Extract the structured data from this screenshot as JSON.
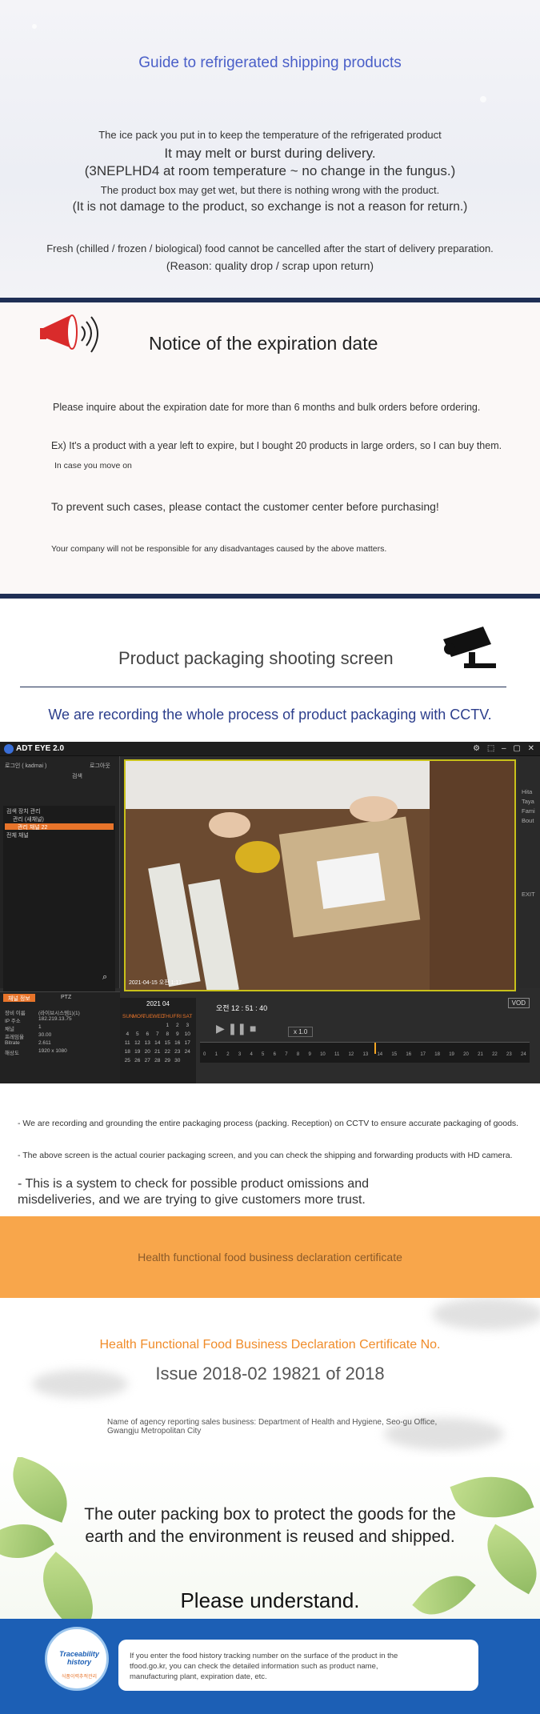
{
  "refrigerated": {
    "title": "Guide to refrigerated shipping products",
    "line1": "The ice pack you put in to keep the temperature of the refrigerated product",
    "line2": "It may melt or burst during delivery.",
    "line3": "(3NEPLHD4 at room temperature ~ no change in the fungus.)",
    "line4": "The product box may get wet, but there is nothing wrong with the product.",
    "line5": "(It is not damage to the product, so exchange is not a reason for return.)",
    "line6": "Fresh (chilled / frozen / biological) food cannot be cancelled after the start of delivery preparation.",
    "line7": "(Reason: quality drop / scrap upon return)"
  },
  "expiration": {
    "title": "Notice of the expiration date",
    "p1": "Please inquire about the expiration date for more than 6 months and bulk orders before ordering.",
    "p2": "Ex) It's a product with a year left to expire, but I bought 20 products in large orders, so I can buy them.",
    "p3": "In case you move on",
    "p4": "To prevent such cases, please contact the customer center before purchasing!",
    "p5": "Your company will not be responsible for any disadvantages caused by the above matters."
  },
  "cctv": {
    "title": "Product packaging shooting screen",
    "subtitle": "We are recording the whole process of product packaging with CCTV."
  },
  "app": {
    "title": "ADT EYE 2.0",
    "login_label": "로그인 ( kadmai )",
    "logout_label": "로그아웃",
    "search_label": "검색",
    "tree": [
      "검색 장치 관리",
      "관리 (새채널)",
      "관리 채널 22",
      "전체 채널"
    ],
    "right_labels": [
      "Hita",
      "Taya",
      "Fami",
      "Bout"
    ],
    "exit_label": "EXIT",
    "info_tabs": [
      "채널 정보",
      "PTZ"
    ],
    "info_rows": [
      {
        "k": "장비 이름",
        "v": "(라이브시스템1)(1)"
      },
      {
        "k": "IP 주소",
        "v": "182.219.13.75"
      },
      {
        "k": "채널",
        "v": "1"
      },
      {
        "k": "프레임율",
        "v": "30.00"
      },
      {
        "k": "Bitrate",
        "v": "2.611"
      },
      {
        "k": "해상도",
        "v": "1920 x 1080"
      }
    ],
    "calendar": {
      "month": "2021  04",
      "days": [
        "SUN",
        "MON",
        "TUE",
        "WED",
        "THU",
        "FRI",
        "SAT"
      ],
      "dates": [
        "",
        "",
        "",
        "",
        "1",
        "2",
        "3",
        "4",
        "5",
        "6",
        "7",
        "8",
        "9",
        "10",
        "11",
        "12",
        "13",
        "14",
        "15",
        "16",
        "17",
        "18",
        "19",
        "20",
        "21",
        "22",
        "23",
        "24",
        "25",
        "26",
        "27",
        "28",
        "29",
        "30",
        ""
      ]
    },
    "time": "오전  12 : 51 : 40",
    "speed": "x 1.0",
    "vod_label": "VOD",
    "hours": [
      "0",
      "1",
      "2",
      "3",
      "4",
      "5",
      "6",
      "7",
      "8",
      "9",
      "10",
      "11",
      "12",
      "13",
      "14",
      "15",
      "16",
      "17",
      "18",
      "19",
      "20",
      "21",
      "22",
      "23",
      "24"
    ],
    "timestamp": "2021-04-15 오전 1:17"
  },
  "explain": {
    "p1": "- We are recording and grounding the entire packaging process (packing. Reception) on CCTV to ensure accurate packaging of goods.",
    "p2": "- The above screen is the actual courier packaging screen, and you can check the shipping and forwarding products with HD camera.",
    "p3": "- This is a system to check for possible product omissions and misdeliveries, and we are trying to give customers more trust."
  },
  "banner": {
    "text": "Health functional food business declaration certificate"
  },
  "certificate": {
    "heading": "Health Functional Food Business Declaration Certificate No.",
    "issue": "Issue 2018-02 19821 of 2018",
    "agency": "Name of agency reporting sales business: Department of Health and Hygiene, Seo-gu Office, Gwangju Metropolitan City"
  },
  "eco": {
    "line1": "The outer packing box to protect the goods for the",
    "line2": "earth and the environment is reused and shipped.",
    "line3": "Please understand."
  },
  "trace": {
    "badge_title": "Traceability history",
    "badge_sub": "식품이력추적관리",
    "text": "If you enter the food history tracking number on the surface of the product in the tfood.go.kr, you can check the detailed information such as product name, manufacturing plant, expiration date, etc."
  },
  "colors": {
    "accent_blue": "#4a5fc8",
    "navy": "#1f2f55",
    "orange": "#f8a64b",
    "footer_blue": "#1c5fb5"
  }
}
